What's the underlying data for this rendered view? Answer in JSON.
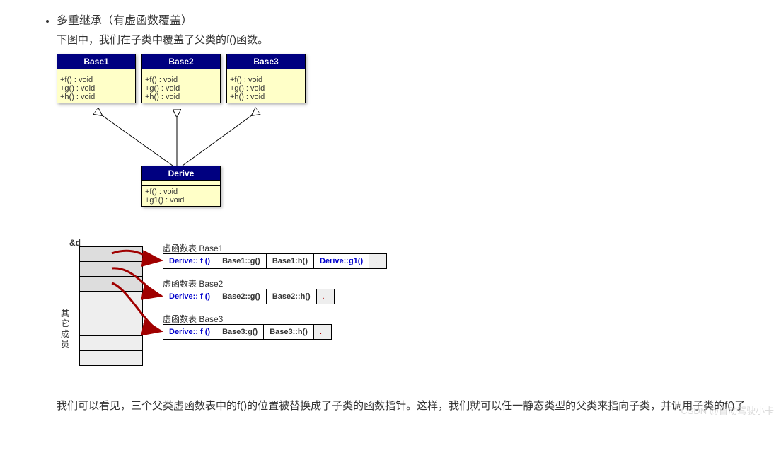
{
  "bullet": {
    "title": "多重继承（有虚函数覆盖）",
    "subtitle": "下图中，我们在子类中覆盖了父类的f()函数。"
  },
  "uml": {
    "base1": {
      "name": "Base1",
      "methods": [
        "+f() : void",
        "+g() : void",
        "+h() : void"
      ]
    },
    "base2": {
      "name": "Base2",
      "methods": [
        "+f() : void",
        "+g() : void",
        "+h() : void"
      ]
    },
    "base3": {
      "name": "Base3",
      "methods": [
        "+f() : void",
        "+g() : void",
        "+h() : void"
      ]
    },
    "derive": {
      "name": "Derive",
      "methods": [
        "+f() : void",
        "+g1() : void"
      ]
    }
  },
  "vtable": {
    "addr": "&d",
    "side_label": "其它成员",
    "labels": {
      "l1": "虚函数表 Base1",
      "l2": "虚函数表 Base2",
      "l3": "虚函数表 Base3"
    },
    "row1": [
      "Derive:: f ()",
      "Base1::g()",
      "Base1:h()",
      "Derive::g1()",
      "."
    ],
    "row2": [
      "Derive:: f ()",
      "Base2::g()",
      "Base2::h()",
      "."
    ],
    "row3": [
      "Derive:: f ()",
      "Base3:g()",
      "Base3::h()",
      "."
    ]
  },
  "paragraph": "我们可以看见，三个父类虚函数表中的f()的位置被替换成了子类的函数指针。这样，我们就可以任一静态类型的父类来指向子类，并调用子类的f()了",
  "watermark": "CSDN @自动驾驶小卡"
}
